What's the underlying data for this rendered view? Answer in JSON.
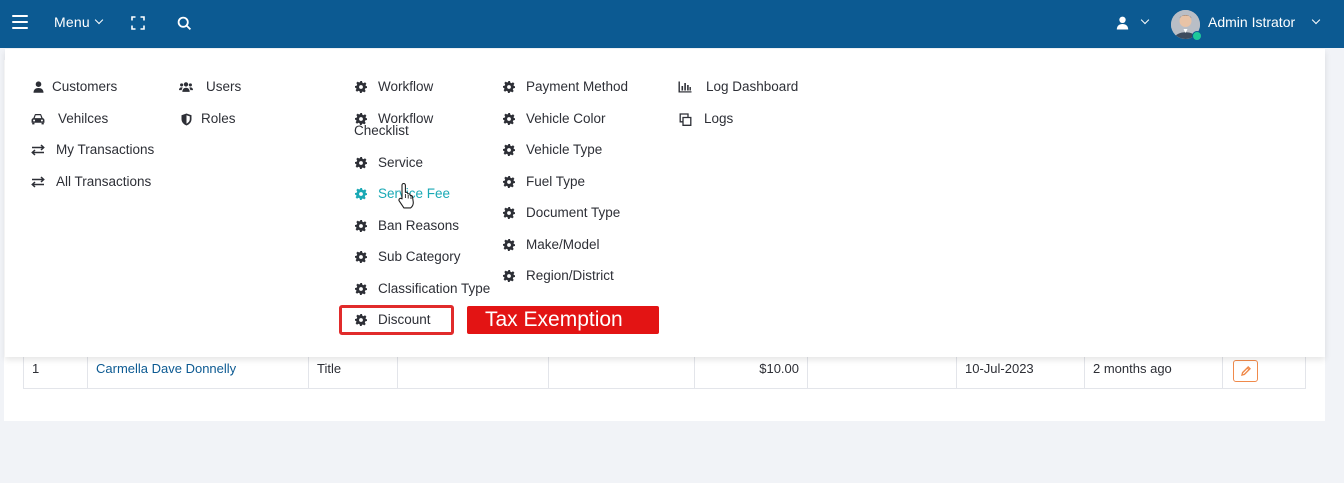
{
  "topbar": {
    "menu_label": "Menu",
    "username": "Admin Istrator",
    "colors": {
      "bar": "#0c5a92",
      "online": "#1ec99a"
    }
  },
  "mega_menu": {
    "col1": [
      "Customers",
      "Vehilces",
      "My Transactions",
      "All Transactions"
    ],
    "col2": [
      "Users",
      "Roles"
    ],
    "col3": [
      "Workflow",
      "Workflow",
      "Checklist",
      "Service",
      "Service Fee",
      "Ban Reasons",
      "Sub Category",
      "Classification Type",
      "Discount"
    ],
    "col4": [
      "Payment Method",
      "Vehicle Color",
      "Vehicle Type",
      "Fuel Type",
      "Document Type",
      "Make/Model",
      "Region/District"
    ],
    "col5": [
      "Log Dashboard",
      "Logs"
    ],
    "active_item": "Service Fee",
    "active_color": "#1aa9b5"
  },
  "annotation": {
    "banner": "Tax Exemption",
    "color": "#e31414"
  },
  "table": {
    "row": {
      "no": "1",
      "name": "Carmella Dave Donnelly",
      "type": "Title",
      "col4": "",
      "col5": "",
      "amount": "$10.00",
      "col7": "",
      "date": "10-Jul-2023",
      "ago": "2 months ago"
    }
  }
}
